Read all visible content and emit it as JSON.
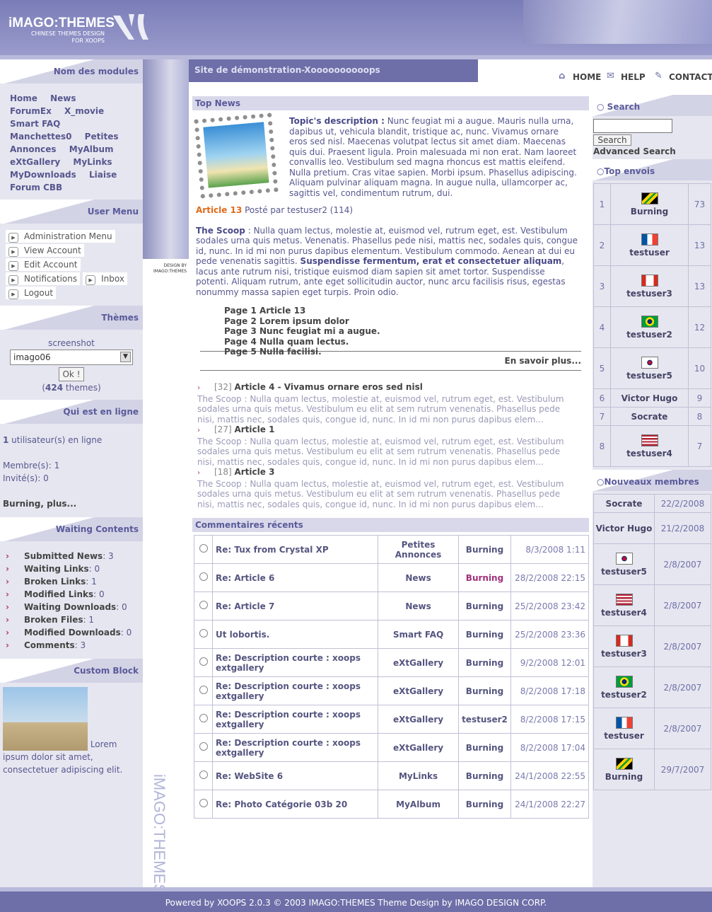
{
  "header": {
    "logo": "iMAGO:THEMES",
    "logo_sub": "CHINESE THEMES DESIGN FOR XOOPS"
  },
  "nav": {
    "home": "HOME",
    "help": "HELP",
    "contact": "CONTACT"
  },
  "site_title": "Site de démonstration-Xoooooooooops",
  "modules": {
    "title": "Nom des modules",
    "items": [
      "Home",
      "News",
      "ForumEx",
      "X_movie",
      "Smart FAQ",
      "Manchettes0",
      "Petites Annonces",
      "MyAlbum",
      "eXtGallery",
      "MyLinks",
      "MyDownloads",
      "Liaise",
      "Forum CBB"
    ]
  },
  "user_menu": {
    "title": "User Menu",
    "items": [
      "Administration Menu",
      "View Account",
      "Edit Account",
      "Notifications",
      "Inbox",
      "Logout"
    ]
  },
  "themes": {
    "title": "Thèmes",
    "screenshot": "screenshot",
    "selected": "imago06",
    "ok": "Ok !",
    "count_pre": "(",
    "count": "424",
    "count_post": " themes)"
  },
  "online": {
    "title": "Qui est en ligne",
    "count": "1",
    "count_text": " utilisateur(s) en ligne",
    "members": "Membre(s): 1",
    "guests": "Invité(s): 0",
    "more": "Burning, plus..."
  },
  "waiting": {
    "title": "Waiting Contents",
    "items": [
      {
        "label": "Submitted News",
        "val": ": 3"
      },
      {
        "label": "Waiting Links",
        "val": ": 0"
      },
      {
        "label": "Broken Links",
        "val": ": 1"
      },
      {
        "label": "Modified Links",
        "val": ": 0"
      },
      {
        "label": "Waiting Downloads",
        "val": ": 0"
      },
      {
        "label": "Broken Files",
        "val": ": 1"
      },
      {
        "label": "Modified Downloads",
        "val": ": 0"
      },
      {
        "label": "Comments",
        "val": ": 3"
      }
    ]
  },
  "custom": {
    "title": "Custom Block",
    "text": "Lorem ipsum dolor sit amet, consectetuer adipiscing elit."
  },
  "topnews": {
    "title": "Top News",
    "desc_label": "Topic's description :",
    "desc": " Nunc feugiat mi a augue. Mauris nulla urna, dapibus ut, vehicula blandit, tristique ac, nunc. Vivamus ornare eros sed nisl. Maecenas volutpat lectus sit amet diam. Maecenas quis dui. Praesent ligula. Proin malesuada mi non erat. Nam laoreet convallis leo. Vestibulum sed magna rhoncus est mattis eleifend. Nulla pretium. Cras vitae sapien. Morbi ipsum. Phasellus adipiscing. Aliquam pulvinar aliquam magna. In augue nulla, ullamcorper ac, sagittis vel, condimentum rutrum, dui.",
    "article": "Article 13",
    "posted": " Posté par testuser2 (114)",
    "scoop_label": "The Scoop",
    "scoop1": " : Nulla quam lectus, molestie at, euismod vel, rutrum eget, est. Vestibulum sodales urna quis metus. Venenatis. Phasellus pede nisi, mattis nec, sodales quis, congue id, nunc. In id mi non purus dapibus elementum. Vestibulum commodo. Aenean at dui eu pede venenatis sagittis. ",
    "scoop_bold": "Suspendisse fermentum, erat et consectetuer aliquam",
    "scoop2": ", lacus ante rutrum nisi, tristique euismod diam sapien sit amet tortor. Suspendisse potenti. Aliquam rutrum, ante eget sollicitudin auctor, nunc arcu facilisis risus, egestas nonummy massa sapien eget turpis. Proin odio.",
    "pages": [
      "Page 1 Article 13",
      "Page 2 Lorem ipsum dolor",
      "Page 3 Nunc feugiat mi a augue.",
      "Page 4 Nulla quam lectus.",
      "Page 5 Nulla facilisi."
    ],
    "more": "En savoir plus...",
    "others": [
      {
        "num": "[32]",
        "title": "Article 4 - Vivamus ornare eros sed nisl",
        "text": "The Scoop : Nulla quam lectus, molestie at, euismod vel, rutrum eget, est. Vestibulum sodales urna quis metus. Vestibulum eu elit at sem rutrum venenatis. Phasellus pede nisi, mattis nec, sodales quis, congue id, nunc. In id mi non purus dapibus elem..."
      },
      {
        "num": "[27]",
        "title": "Article 1",
        "text": "The Scoop : Nulla quam lectus, molestie at, euismod vel, rutrum eget, est. Vestibulum sodales urna quis metus. Vestibulum eu elit at sem rutrum venenatis. Phasellus pede nisi, mattis nec, sodales quis, congue id, nunc. In id mi non purus dapibus elem..."
      },
      {
        "num": "[18]",
        "title": "Article 3",
        "text": "The Scoop : Nulla quam lectus, molestie at, euismod vel, rutrum eget, est. Vestibulum sodales urna quis metus. Vestibulum eu elit at sem rutrum venenatis. Phasellus pede nisi, mattis nec, sodales quis, congue id, nunc. In id mi non purus dapibus elem..."
      }
    ]
  },
  "comments": {
    "title": "Commentaires récents",
    "rows": [
      [
        "Re: Tux from Crystal XP",
        "Petites Annonces",
        "Burning",
        "8/3/2008 1:11"
      ],
      [
        "Re: Article 6",
        "News",
        "Burning",
        "28/2/2008 22:15"
      ],
      [
        "Re: Article 7",
        "News",
        "Burning",
        "25/2/2008 23:42"
      ],
      [
        "Ut lobortis.",
        "Smart FAQ",
        "Burning",
        "25/2/2008 23:36"
      ],
      [
        "Re: Description courte : xoops extgallery",
        "eXtGallery",
        "Burning",
        "9/2/2008 12:01"
      ],
      [
        "Re: Description courte : xoops extgallery",
        "eXtGallery",
        "Burning",
        "8/2/2008 17:18"
      ],
      [
        "Re: Description courte : xoops extgallery",
        "eXtGallery",
        "testuser2",
        "8/2/2008 17:15"
      ],
      [
        "Re: Description courte : xoops extgallery",
        "eXtGallery",
        "Burning",
        "8/2/2008 17:04"
      ],
      [
        "Re: WebSite 6",
        "MyLinks",
        "Burning",
        "24/1/2008 22:55"
      ],
      [
        "Re: Photo Catégorie 03b 20",
        "MyAlbum",
        "Burning",
        "24/1/2008 22:27"
      ]
    ]
  },
  "search": {
    "title": "Search",
    "button": "Search",
    "advanced": "Advanced Search"
  },
  "top_posters": {
    "title": "Top envois",
    "rows": [
      [
        "1",
        "Burning",
        "73"
      ],
      [
        "2",
        "testuser",
        "13"
      ],
      [
        "3",
        "testuser3",
        "13"
      ],
      [
        "4",
        "testuser2",
        "12"
      ],
      [
        "5",
        "testuser5",
        "10"
      ],
      [
        "6",
        "Victor Hugo",
        "9"
      ],
      [
        "7",
        "Socrate",
        "8"
      ],
      [
        "8",
        "testuser4",
        "7"
      ]
    ]
  },
  "new_members": {
    "title": "Nouveaux membres",
    "rows": [
      [
        "Socrate",
        "22/2/2008"
      ],
      [
        "Victor Hugo",
        "21/2/2008"
      ],
      [
        "testuser5",
        "2/8/2007"
      ],
      [
        "testuser4",
        "2/8/2007"
      ],
      [
        "testuser3",
        "2/8/2007"
      ],
      [
        "testuser2",
        "2/8/2007"
      ],
      [
        "testuser",
        "2/8/2007"
      ],
      [
        "Burning",
        "29/7/2007"
      ]
    ]
  },
  "footer": "Powered by XOOPS 2.0.3 © 2003 IMAGO:THEMES Theme Design by IMAGO DESIGN CORP.",
  "strip": {
    "design_by": "DESIGN BY",
    "imago": "IMAGO:THEMES",
    "vertical": "iMAGO:THEMES"
  }
}
